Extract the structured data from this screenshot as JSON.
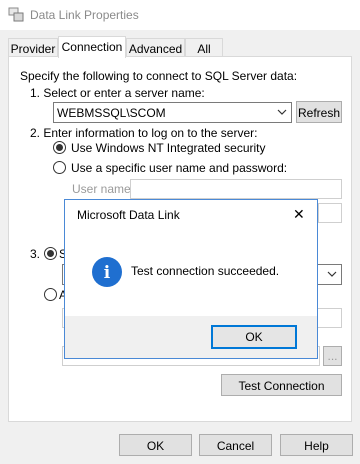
{
  "window": {
    "title": "Data Link Properties"
  },
  "tabs": [
    {
      "label": "Provider"
    },
    {
      "label": "Connection"
    },
    {
      "label": "Advanced"
    },
    {
      "label": "All"
    }
  ],
  "connection": {
    "intro": "Specify the following to connect to SQL Server data:",
    "step1_label": "1. Select or enter a server name:",
    "server_name": "WEBMSSQL\\SCOM",
    "refresh_label": "Refresh",
    "step2_label": "2. Enter information to log on to the server:",
    "option_nt": "Use Windows NT Integrated security",
    "option_specific": "Use a specific user name and password:",
    "username_label": "User name:",
    "step3_label": "3.",
    "step3_option_prefix": "S",
    "step3_option2_prefix": "A",
    "browse_label": "...",
    "test_connection_label": "Test Connection"
  },
  "footer": {
    "ok_label": "OK",
    "cancel_label": "Cancel",
    "help_label": "Help"
  },
  "message_box": {
    "title": "Microsoft Data Link",
    "message": "Test connection succeeded.",
    "ok_label": "OK",
    "icon_glyph": "i",
    "close_glyph": "✕"
  },
  "colors": {
    "accent": "#0078d7",
    "info_icon": "#1f6fd0"
  }
}
